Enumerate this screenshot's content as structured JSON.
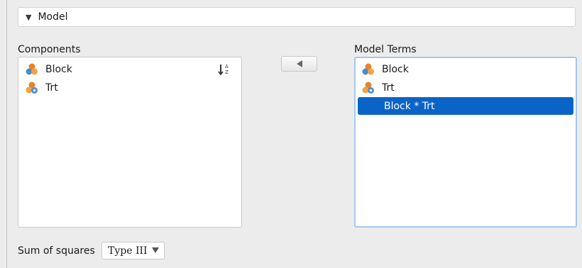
{
  "section": {
    "title": "Model",
    "toggle_icon": "triangle-down-icon"
  },
  "components": {
    "label": "Components",
    "items": [
      {
        "label": "Block",
        "icon": "nominal-variable-icon"
      },
      {
        "label": "Trt",
        "icon": "nominal-text-variable-icon"
      }
    ],
    "sort_icon": "sort-alphabetical-icon"
  },
  "move_button": {
    "icon": "arrow-left-icon"
  },
  "model_terms": {
    "label": "Model Terms",
    "items": [
      {
        "label": "Block",
        "icon": "nominal-variable-icon"
      },
      {
        "label": "Trt",
        "icon": "nominal-text-variable-icon"
      },
      {
        "label": "Block * Trt",
        "selected": true
      }
    ]
  },
  "sum_of_squares": {
    "label": "Sum of squares",
    "value": "Type III"
  },
  "colors": {
    "selection": "#0a64c8",
    "focus_border": "#a6c8ec",
    "icon_orange": "#e8832a",
    "icon_blue": "#4c8dc8"
  }
}
